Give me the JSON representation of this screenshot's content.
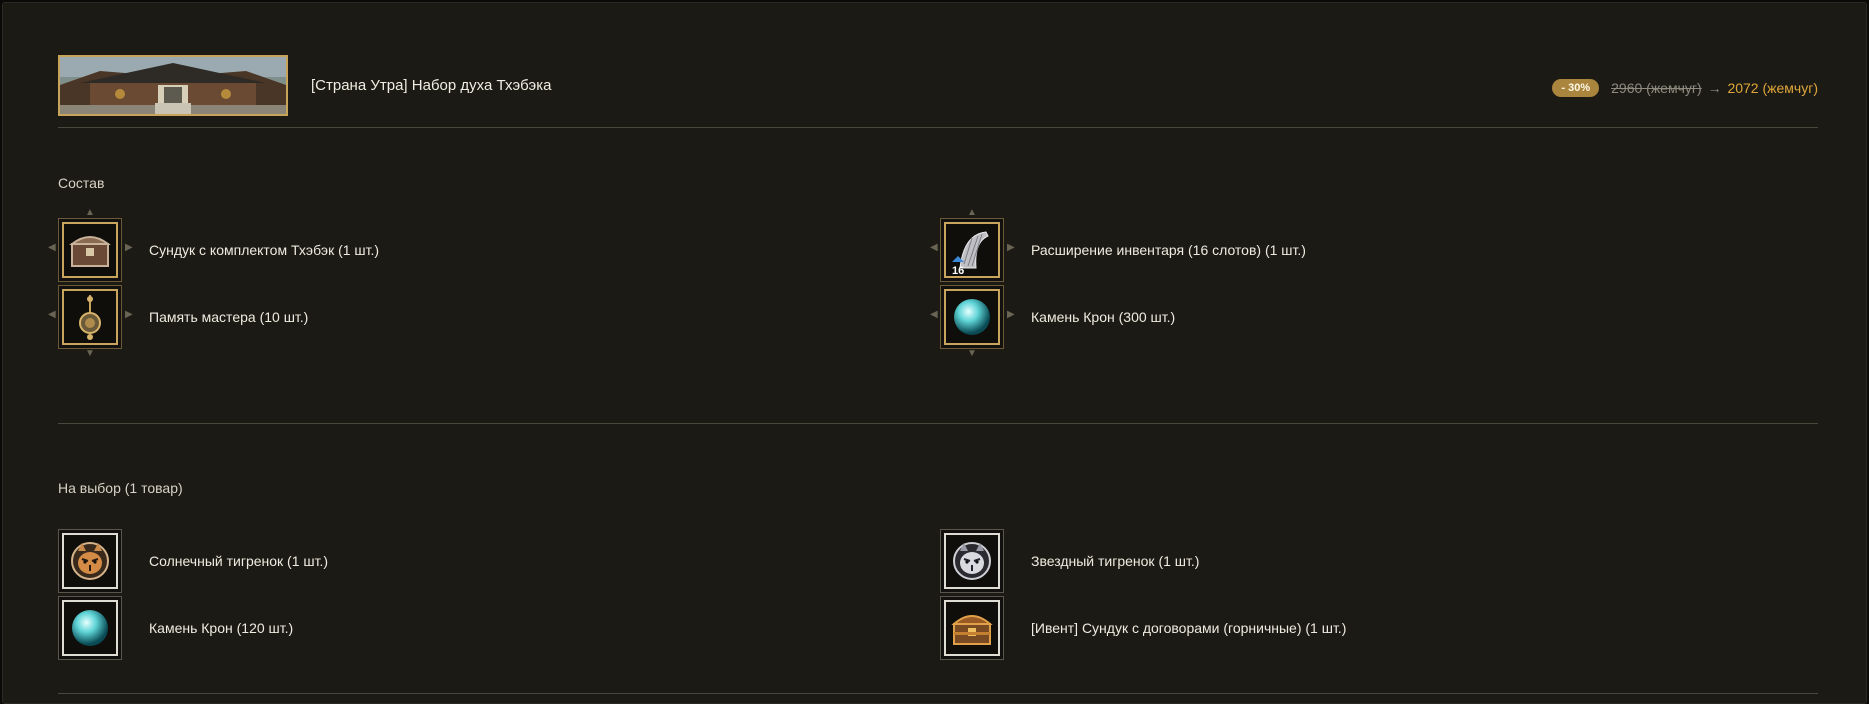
{
  "product": {
    "title": "[Страна Утра] Набор духа Тхэбэка",
    "discount_badge": "- 30%",
    "old_price": "2960 (жемчуг)",
    "arrow": "→",
    "new_price": "2072 (жемчуг)"
  },
  "composition": {
    "heading": "Состав",
    "items": [
      {
        "label": "Сундук с комплектом Тхэбэк (1 шт.)",
        "icon": "chest-icon"
      },
      {
        "label": "Расширение инвентаря (16 слотов) (1 шт.)",
        "icon": "inventory-expansion-icon",
        "badge": "16"
      },
      {
        "label": "Память мастера (10 шт.)",
        "icon": "amulet-icon"
      },
      {
        "label": "Камень Крон (300 шт.)",
        "icon": "cron-stone-icon"
      }
    ]
  },
  "choice": {
    "heading": "На выбор (1 товар)",
    "items": [
      {
        "label": "Солнечный тигренок (1 шт.)",
        "icon": "sun-tiger-icon"
      },
      {
        "label": "Звездный тигренок (1 шт.)",
        "icon": "star-tiger-icon"
      },
      {
        "label": "Камень Крон (120 шт.)",
        "icon": "cron-stone-icon"
      },
      {
        "label": "[Ивент] Сундук с договорами (горничные) (1 шт.)",
        "icon": "treasure-chest-icon"
      }
    ]
  },
  "colors": {
    "accent_gold": "#c9a45c",
    "new_price": "#e0a63a",
    "badge": "#a9853d",
    "background": "#1b1a14"
  }
}
